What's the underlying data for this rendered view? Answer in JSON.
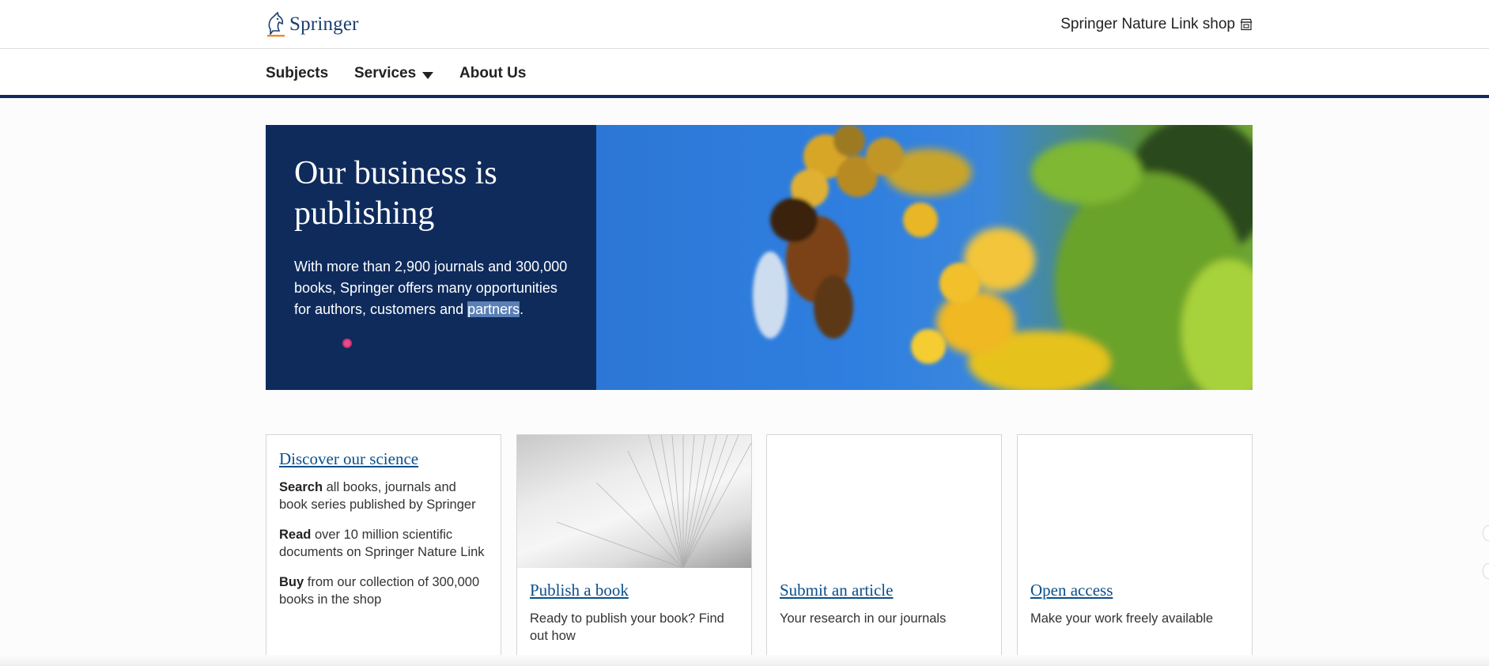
{
  "header": {
    "logo_text": "Springer",
    "shop_link": "Springer Nature Link shop",
    "shop_icon": "shop-icon"
  },
  "nav": {
    "subjects": "Subjects",
    "services": "Services",
    "about": "About Us"
  },
  "hero": {
    "title": "Our business is publishing",
    "text_main": "With more than 2,900 journals and 300,000 books, Springer offers many opportunities for authors, customers and ",
    "text_highlight": "partners",
    "text_end": "."
  },
  "cards": {
    "discover": {
      "title": "Discover our science",
      "items": [
        {
          "bold": "Search",
          "text": " all books, journals and book series published by Springer"
        },
        {
          "bold": "Read",
          "text": " over 10 million scientific documents on Springer Nature Link"
        },
        {
          "bold": "Buy",
          "text": " from our collection of 300,000 books in the shop"
        }
      ]
    },
    "publish": {
      "title": "Publish a book",
      "desc": "Ready to publish your book? Find out how"
    },
    "submit": {
      "title": "Submit an article",
      "desc": "Your research in our journals"
    },
    "open_access": {
      "title": "Open access",
      "desc": "Make your work freely available"
    }
  },
  "colors": {
    "brand_navy": "#0e2b5c",
    "link_blue": "#0a4f8c",
    "hero_sky": "#2f7fe0"
  }
}
